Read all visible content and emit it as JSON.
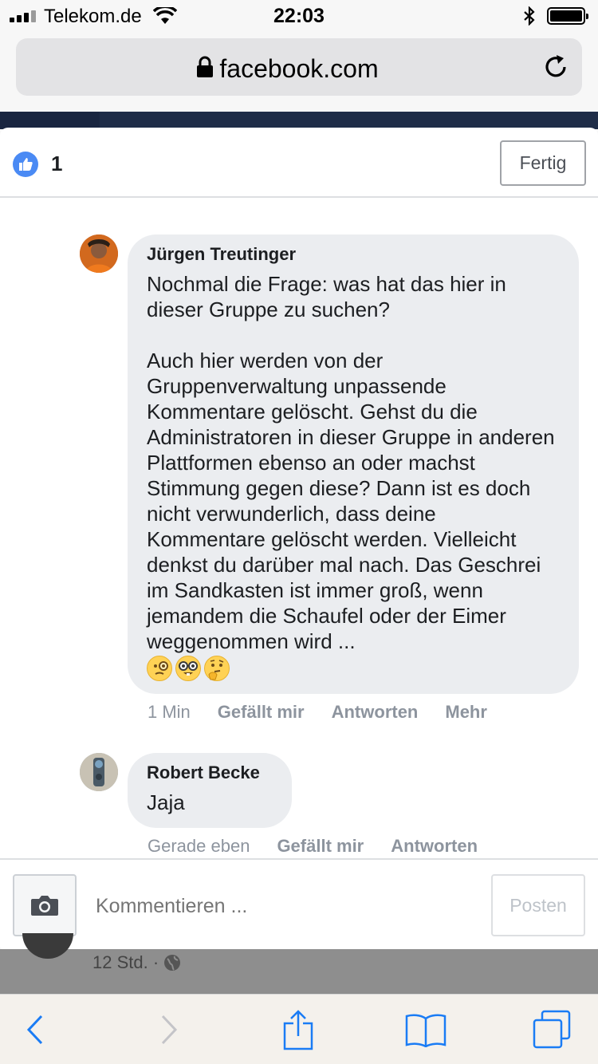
{
  "status_bar": {
    "carrier": "Telekom.de",
    "time": "22:03"
  },
  "browser": {
    "url": "facebook.com"
  },
  "modal": {
    "like_count": "1",
    "done_label": "Fertig"
  },
  "comments": [
    {
      "author": "Jürgen Treutinger",
      "text": "Nochmal die Frage: was hat das hier in dieser Gruppe zu suchen?\n\nAuch hier werden von der Gruppenverwaltung unpassende Kommentare gelöscht. Gehst du die Administratoren in dieser Gruppe in anderen Plattformen ebenso an oder machst Stimmung gegen diese? Dann ist es doch nicht verwunderlich, dass deine Kommentare gelöscht werden. Vielleicht denkst du darüber mal nach. Das Geschrei im Sandkasten ist immer groß, wenn jemandem die Schaufel oder der Eimer weggenommen wird ...",
      "emojis": [
        "face-with-monocle-emoji",
        "nerd-face-emoji",
        "thinking-face-emoji"
      ],
      "time": "1 Min",
      "like": "Gefällt mir",
      "reply": "Antworten",
      "more": "Mehr"
    },
    {
      "author": "Robert Becke",
      "text": "Jaja",
      "time": "Gerade eben",
      "like": "Gefällt mir",
      "reply": "Antworten"
    }
  ],
  "composer": {
    "placeholder": "Kommentieren ...",
    "post_label": "Posten"
  },
  "background_post": {
    "meta": "12 Std. ·"
  },
  "colors": {
    "facebook_blue": "#4a8af4",
    "bubble": "#ebedf0",
    "safari_blue": "#1a7cf5"
  }
}
